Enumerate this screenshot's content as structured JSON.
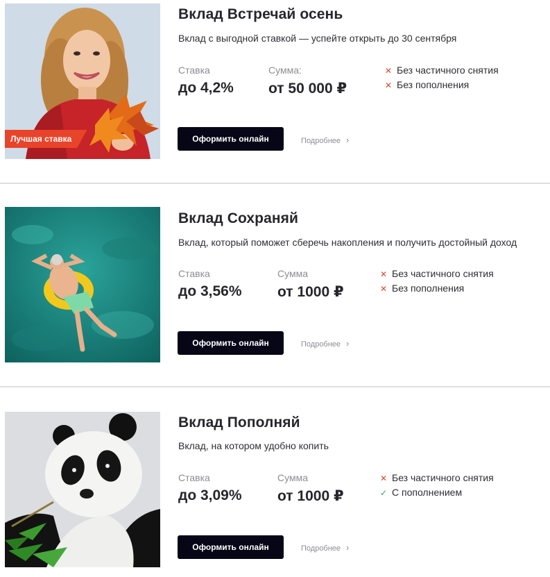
{
  "deposits": [
    {
      "title": "Вклад Встречай осень",
      "description": "Вклад с выгодной ставкой — успейте открыть до 30 сентября",
      "badge": "Лучшая ставка",
      "rate_label": "Ставка",
      "rate_value": "до 4,2%",
      "amount_label": "Сумма:",
      "amount_value": "от 50 000 ₽",
      "features": [
        {
          "icon": "cross-icon",
          "mark": "✕",
          "text": "Без частичного снятия"
        },
        {
          "icon": "cross-icon",
          "mark": "✕",
          "text": "Без пополнения"
        }
      ],
      "button_label": "Оформить онлайн",
      "more_label": "Подробнее",
      "image": "woman-autumn-leaves-photo"
    },
    {
      "title": "Вклад Сохраняй",
      "description": "Вклад, который поможет сберечь накопления и получить достойный доход",
      "rate_label": "Ставка",
      "rate_value": "до 3,56%",
      "amount_label": "Сумма",
      "amount_value": "от 1000 ₽",
      "features": [
        {
          "icon": "cross-icon",
          "mark": "✕",
          "text": "Без частичного снятия"
        },
        {
          "icon": "cross-icon",
          "mark": "✕",
          "text": "Без пополнения"
        }
      ],
      "button_label": "Оформить онлайн",
      "more_label": "Подробнее",
      "image": "man-floating-sea-photo"
    },
    {
      "title": "Вклад Пополняй",
      "description": "Вклад, на котором удобно копить",
      "rate_label": "Ставка",
      "rate_value": "до 3,09%",
      "amount_label": "Сумма",
      "amount_value": "от 1000 ₽",
      "features": [
        {
          "icon": "cross-icon",
          "mark": "✕",
          "text": "Без частичного снятия"
        },
        {
          "icon": "check-icon",
          "mark": "✓",
          "text": "С пополнением"
        }
      ],
      "button_label": "Оформить онлайн",
      "more_label": "Подробнее",
      "image": "panda-bamboo-photo"
    }
  ],
  "colors": {
    "accent": "#e8442a",
    "button": "#060616",
    "check": "#3aa35e",
    "muted": "#8d8d93"
  }
}
